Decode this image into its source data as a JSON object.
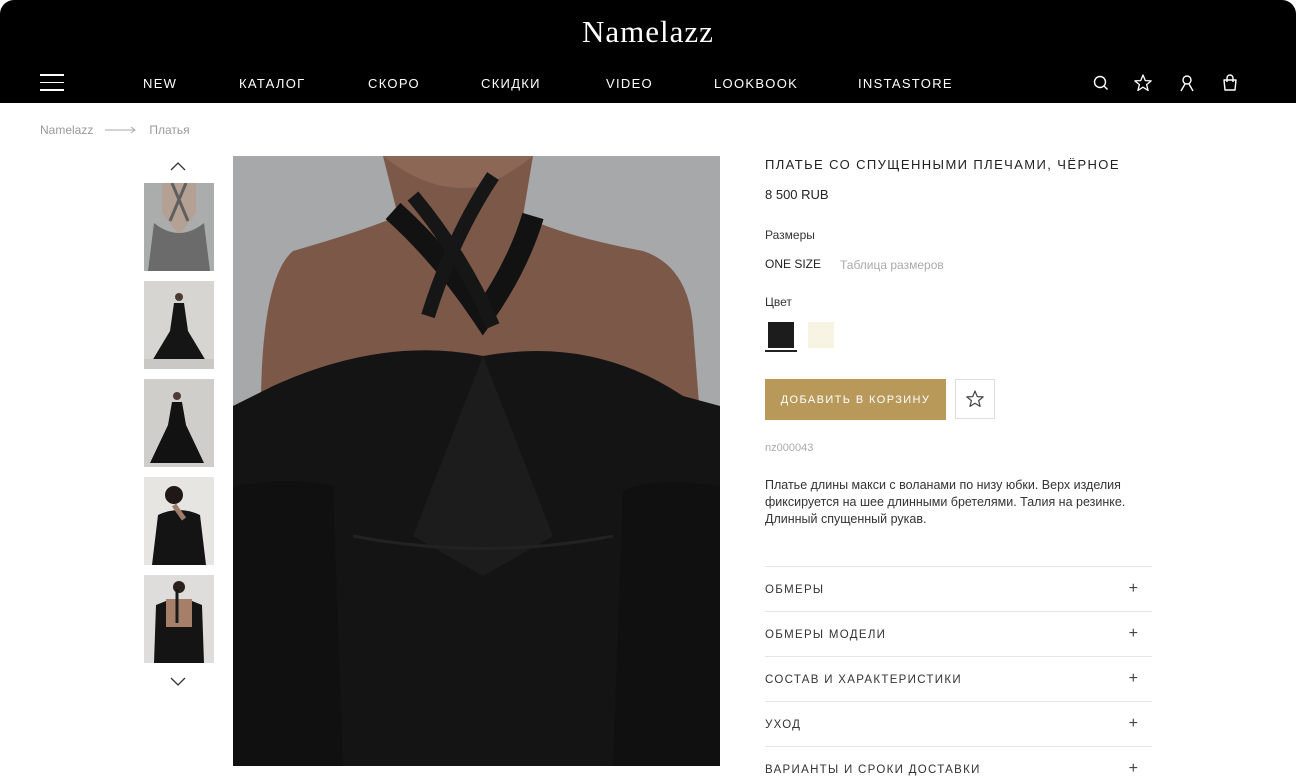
{
  "header": {
    "logo": "Namelazz",
    "nav": [
      "NEW",
      "КАТАЛОГ",
      "СКОРО",
      "СКИДКИ",
      "VIDEO",
      "LOOKBOOK",
      "INSTASTORE"
    ]
  },
  "breadcrumb": {
    "home": "Namelazz",
    "current": "Платья"
  },
  "product": {
    "title": "ПЛАТЬЕ СО СПУЩЕННЫМИ ПЛЕЧАМИ, ЧЁРНОЕ",
    "price": "8 500 RUB",
    "sizes_label": "Размеры",
    "size_value": "ONE SIZE",
    "size_table": "Таблица размеров",
    "color_label": "Цвет",
    "colors": [
      "#1c1c1c",
      "#f7f4e3"
    ],
    "add_to_cart": "ДОБАВИТЬ В КОРЗИНУ",
    "sku": "nz000043",
    "description": "Платье длины макси с воланами по низу юбки. Верх изделия фиксируется на шее длинными бретелями. Талия на резинке. Длинный спущенный рукав."
  },
  "accordion": [
    "ОБМЕРЫ",
    "ОБМЕРЫ МОДЕЛИ",
    "СОСТАВ И ХАРАКТЕРИСТИКИ",
    "УХОД",
    "ВАРИАНТЫ И СРОКИ ДОСТАВКИ"
  ],
  "accordion_icon": "+",
  "colors": {
    "header_bg": "#000000",
    "accent": "#b8995a"
  }
}
